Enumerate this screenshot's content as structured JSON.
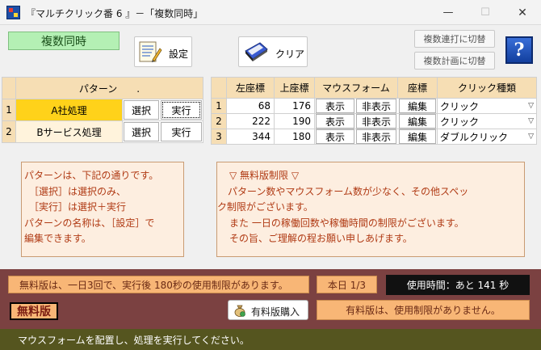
{
  "window": {
    "title": "『マルチクリック番 6 』－「複数同時」",
    "minimize_glyph": "—",
    "maximize_glyph": "☐",
    "close_glyph": "✕"
  },
  "mode_label": "複数同時",
  "toolbar": {
    "settings_label": "設定",
    "clear_label": "クリア",
    "switch_burst_label": "複数連打に切替",
    "switch_plan_label": "複数計画に切替",
    "help_glyph": "?"
  },
  "icons": {
    "settings": "document-pencil-icon",
    "clear": "eraser-icon",
    "help": "help-icon",
    "buy": "money-bag-icon"
  },
  "pattern_table": {
    "header": "パターン　　.",
    "rows": [
      {
        "num": "1",
        "name": "A社処理",
        "select_label": "選択",
        "execute_label": "実行",
        "selected": true
      },
      {
        "num": "2",
        "name": "Bサービス処理",
        "select_label": "選択",
        "execute_label": "実行",
        "selected": false
      }
    ]
  },
  "coord_table": {
    "headers": [
      "左座標",
      "上座標",
      "マウスフォーム",
      "座標",
      "クリック種類"
    ],
    "rows": [
      {
        "num": "1",
        "x": "68",
        "y": "176",
        "show_label": "表示",
        "hide_label": "非表示",
        "edit_label": "編集",
        "click_type": "クリック"
      },
      {
        "num": "2",
        "x": "222",
        "y": "190",
        "show_label": "表示",
        "hide_label": "非表示",
        "edit_label": "編集",
        "click_type": "クリック"
      },
      {
        "num": "3",
        "x": "344",
        "y": "180",
        "show_label": "表示",
        "hide_label": "非表示",
        "edit_label": "編集",
        "click_type": "ダブルクリック"
      }
    ]
  },
  "pattern_help": {
    "lines": [
      "パターンは、下記の通りです。",
      "　［選択］は選択のみ、",
      "　［実行］は選択＋実行",
      "パターンの名称は、［設定］で",
      "編集できます。"
    ]
  },
  "limit_notice": {
    "lines": [
      "▽ 無料版制限 ▽",
      "パターン数やマウスフォーム数が少なく、その他スペッ",
      "ク制限がございます。",
      "また 一日の稼働回数や稼働時間の制限がございます。",
      "その旨、ご理解の程お願い申しあげます。"
    ]
  },
  "bottom": {
    "trial_usage_text": "無料版は、一日3回で、実行後 180秒の使用制限があります。",
    "today_count": "本日 1/3",
    "usage_time": "使用時間：あと 141 秒",
    "free_badge": "無料版",
    "buy_label": "有料版購入",
    "paid_version_text": "有料版は、使用制限がありません。"
  },
  "status_bar": "マウスフォームを配置し、処理を実行してください。"
}
